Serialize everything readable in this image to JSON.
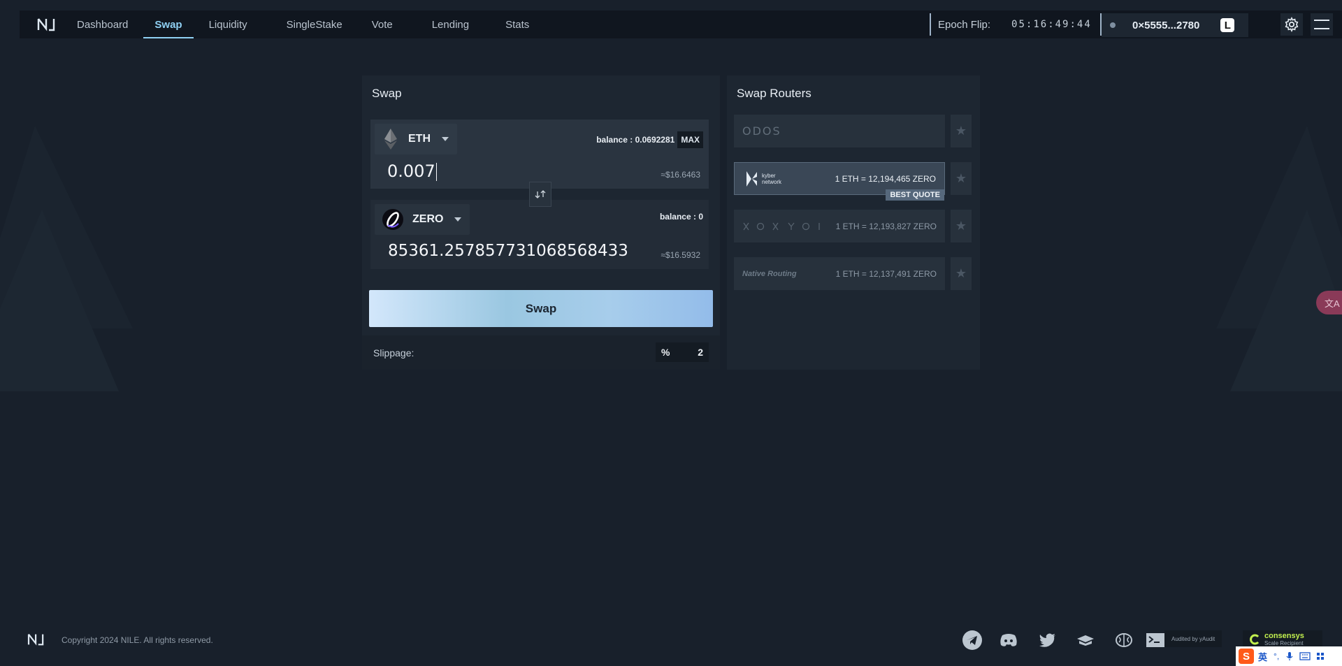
{
  "nav": {
    "items": [
      {
        "label": "Dashboard",
        "active": false
      },
      {
        "label": "Swap",
        "active": true
      },
      {
        "label": "Liquidity",
        "active": false
      },
      {
        "label": "SingleStake",
        "active": false
      },
      {
        "label": "Vote",
        "active": false
      },
      {
        "label": "Lending",
        "active": false
      },
      {
        "label": "Stats",
        "active": false
      }
    ],
    "epoch_label": "Epoch Flip:",
    "epoch_timer": "05:16:49:44",
    "wallet_address": "0×5555...2780",
    "wallet_badge": "L"
  },
  "swap": {
    "title": "Swap",
    "from": {
      "token": "ETH",
      "balance_label": "balance :",
      "balance_value": "0.0692281",
      "max_label": "MAX",
      "amount": "0.007",
      "usd": "≈$16.6463"
    },
    "to": {
      "token": "ZERO",
      "balance_label": "balance :",
      "balance_value": "0",
      "amount": "85361.257857731068568433",
      "usd": "≈$16.5932"
    },
    "button_label": "Swap",
    "slippage_label": "Slippage:",
    "slippage_unit": "%",
    "slippage_value": "2"
  },
  "routers": {
    "title": "Swap Routers",
    "items": [
      {
        "name": "ODOS",
        "quote": "",
        "best": false
      },
      {
        "name": "kyber network",
        "name_line1": "kyber",
        "name_line2": "network",
        "quote": "1 ETH = 12,194,465 ZERO",
        "best": true,
        "badge": "BEST QUOTE"
      },
      {
        "name": "XY",
        "quote": "1 ETH = 12,193,827 ZERO",
        "best": false
      },
      {
        "name": "Native Routing",
        "quote": "1 ETH = 12,137,491 ZERO",
        "best": false
      }
    ]
  },
  "footer": {
    "copyright": "Copyright 2024 NILE. All rights reserved.",
    "audit": "Audited by yAudit",
    "consensys_name": "consensys",
    "consensys_sub": "Scale Recipient"
  },
  "ime": {
    "lang": "英",
    "translate": "文A"
  },
  "colors": {
    "background": "#18202b",
    "panel": "#1d2631",
    "accent": "#8fd0f3",
    "swap_button_start": "#d3e7fb",
    "swap_button_end": "#93bcea"
  },
  "icons": [
    "nile-logo",
    "eth-icon",
    "zero-icon",
    "swap-direction-icon",
    "gear-icon",
    "menu-icon",
    "star-icon",
    "telegram-icon",
    "discord-icon",
    "twitter-icon",
    "docs-icon",
    "brain-icon",
    "terminal-icon"
  ]
}
